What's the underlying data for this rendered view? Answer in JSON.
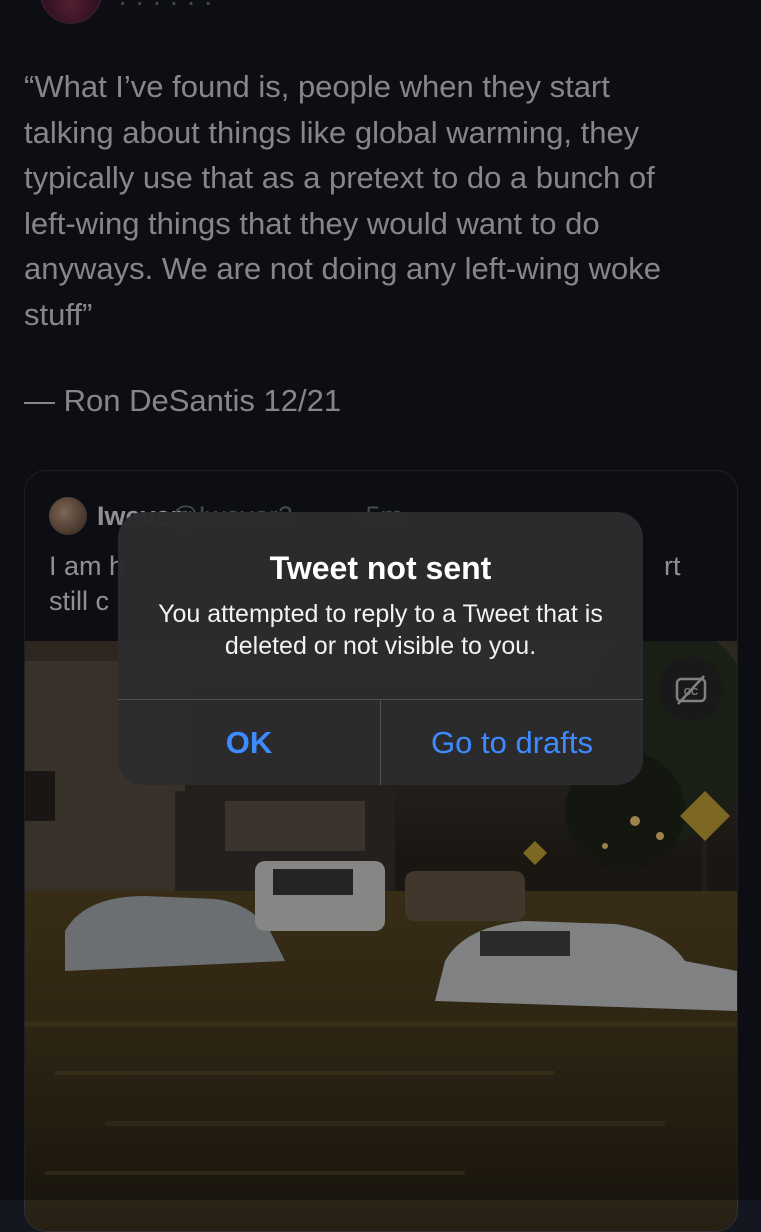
{
  "top_row": {
    "name_partial": "· · ·  · · ·"
  },
  "tweet": {
    "text_lines": [
      "“What I’ve found is, people when they start",
      "talking about things like global warming, they",
      "typically use that as a pretext to do a bunch of",
      "left-wing things that they would want to do",
      "anyways. We are not doing any left-wing woke",
      "stuff”"
    ],
    "attribution": "— Ron DeSantis 12/21"
  },
  "quoted_tweet": {
    "name": "Iwever",
    "handle": "@Iwever2",
    "time": "· 5m",
    "body_line1_left": "I am h",
    "body_line1_right": "rt",
    "body_line2_left": "still c"
  },
  "media": {
    "caption_icon": "closed-captions-off-icon"
  },
  "alert": {
    "title": "Tweet not sent",
    "message": "You attempted to reply to a Tweet that is deleted or not visible to you.",
    "ok_label": "OK",
    "drafts_label": "Go to drafts"
  },
  "colors": {
    "background": "#14171f",
    "accent": "#3d8bff",
    "alert_bg": "#2c2c2e"
  }
}
